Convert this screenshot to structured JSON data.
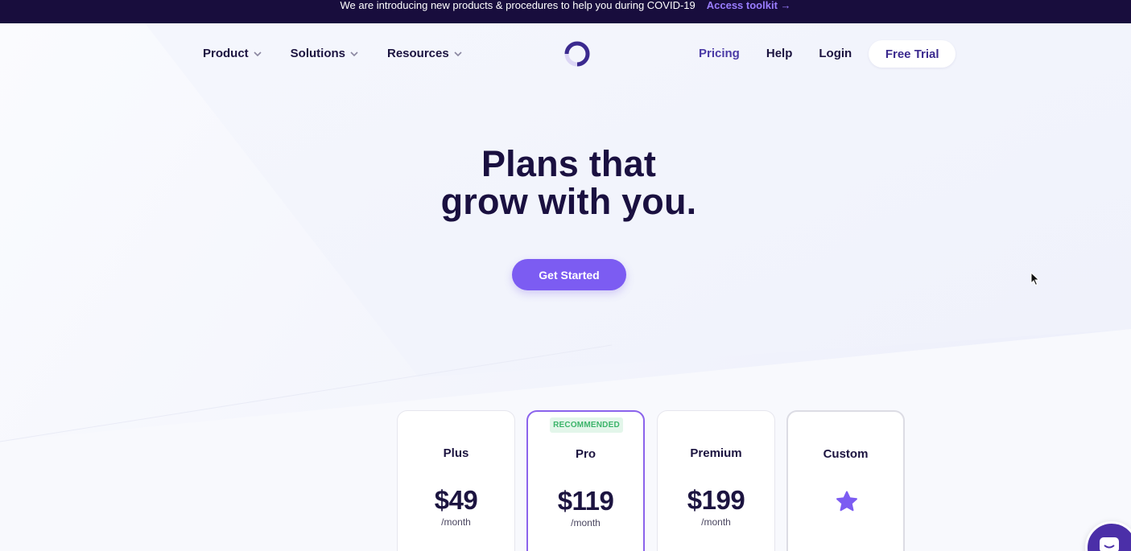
{
  "banner": {
    "text": "We are introducing new products & procedures to help you during COVID-19",
    "link_label": "Access toolkit →"
  },
  "nav": {
    "left": [
      {
        "label": "Product",
        "icon": "chevron-down-icon"
      },
      {
        "label": "Solutions",
        "icon": "chevron-down-icon"
      },
      {
        "label": "Resources",
        "icon": "chevron-down-icon"
      }
    ],
    "right": {
      "pricing": "Pricing",
      "help": "Help",
      "login": "Login",
      "trial_button": "Free Trial"
    },
    "logo": "ring-logo-icon"
  },
  "hero": {
    "title_line1": "Plans that",
    "title_line2": "grow with you.",
    "cta_label": "Get Started"
  },
  "plans": [
    {
      "name": "Plus",
      "price": "$49",
      "period": "/month"
    },
    {
      "name": "Pro",
      "price": "$119",
      "period": "/month",
      "badge": "RECOMMENDED"
    },
    {
      "name": "Premium",
      "price": "$199",
      "period": "/month"
    },
    {
      "name": "Custom",
      "icon": "star-icon"
    }
  ],
  "colors": {
    "banner_bg": "#180d3d",
    "accent": "#7c5cf2",
    "link_accent": "#9a7dff",
    "recommended_badge": "#3cb46a",
    "heading": "#1a1040",
    "chat_bubble": "#4b2fa8"
  }
}
